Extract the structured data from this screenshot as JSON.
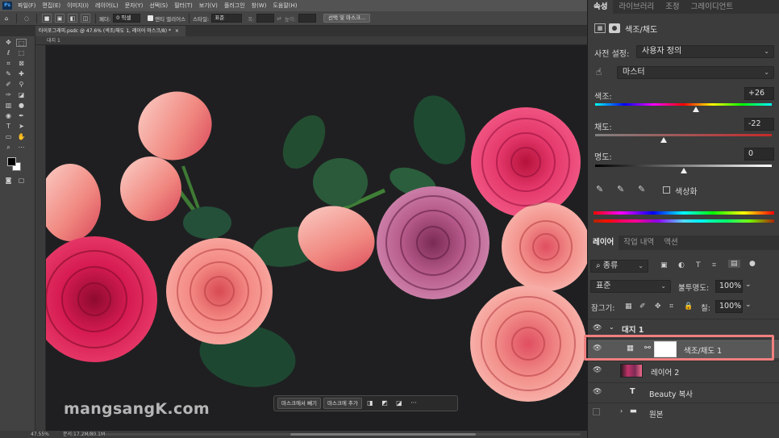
{
  "app": {
    "logo": "Ps"
  },
  "menu": [
    "파일(F)",
    "편집(E)",
    "이미지(I)",
    "레이어(L)",
    "문자(Y)",
    "선택(S)",
    "필터(T)",
    "보기(V)",
    "플러그인",
    "창(W)",
    "도움말(H)"
  ],
  "options_bar": {
    "feather_label": "페더:",
    "feather_value": "0 픽셀",
    "antialias_label": "앤티 앨리어스",
    "style_label": "스타일:",
    "style_value": "표준",
    "width_label": "폭:",
    "height_label": "높이:",
    "select_mask_button": "선택 및 마스크..."
  },
  "document_tab": {
    "title": "타이포그래피.psdc @ 47.6% (색조/채도 1, 레이어 마스크/8) *",
    "close_glyph": "×"
  },
  "canvas": {
    "artboard_label": "대지 1"
  },
  "status": {
    "zoom": "47.55%",
    "doc_info": "문서:17.2M/80.1M"
  },
  "context_bar": {
    "subtract_button": "마스크에서 빼기",
    "add_button": "마스크에 추가",
    "more_glyph": "···"
  },
  "watermark": "mangsangK.com",
  "panels": {
    "tabs": [
      "속성",
      "라이브러리",
      "조정",
      "그레이디언트"
    ],
    "active_tab": 0,
    "properties_title": "색조/채도",
    "preset_label": "사전 설정:",
    "preset_value": "사용자 정의",
    "channel_value": "마스터",
    "hue_label": "색조:",
    "hue_value": "+26",
    "hue_level": 26,
    "saturation_label": "채도:",
    "saturation_value": "-22",
    "saturation_level": -22,
    "lightness_label": "명도:",
    "lightness_value": "0",
    "lightness_level": 0,
    "colorize_label": "색상화"
  },
  "layers_panel": {
    "tabs": [
      "레이어",
      "작업 내역",
      "액션"
    ],
    "active_tab": 0,
    "filter_kind": "종류",
    "blend_mode": "표준",
    "opacity_label": "불투명도:",
    "opacity_value": "100%",
    "lock_label": "잠그기:",
    "fill_label": "칠:",
    "fill_value": "100%",
    "layers": [
      {
        "name": "대지 1",
        "type": "artboard",
        "visible": true
      },
      {
        "name": "색조/채도 1",
        "type": "adjustment",
        "visible": true,
        "selected": true
      },
      {
        "name": "레이어 2",
        "type": "pixel",
        "visible": true
      },
      {
        "name": "Beauty 복사",
        "type": "text",
        "visible": true,
        "glyph": "T"
      },
      {
        "name": "원본",
        "type": "group",
        "visible": false
      }
    ]
  },
  "colors": {
    "highlight": "#f07f7f",
    "panel_bg": "#3c3c3c",
    "canvas_bg": "#1f1f21"
  }
}
